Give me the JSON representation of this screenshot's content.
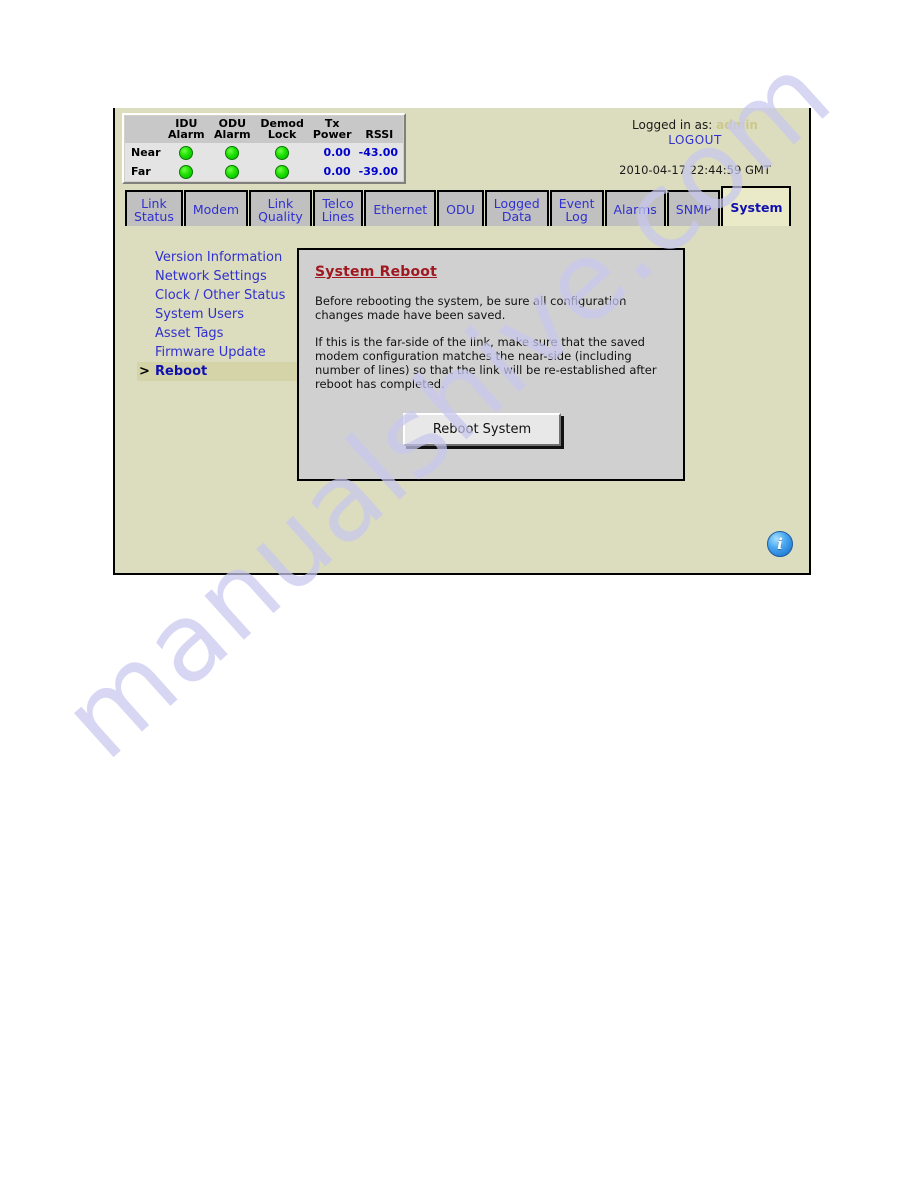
{
  "watermark": {
    "text": "manualshive.com"
  },
  "status_panel": {
    "columns": [
      "",
      "IDU\nAlarm",
      "ODU\nAlarm",
      "Demod\nLock",
      "Tx\nPower",
      "RSSI"
    ],
    "rows": [
      {
        "label": "Near",
        "idu_alarm": "led-green",
        "odu_alarm": "led-green",
        "demod_lock": "led-green",
        "tx_power": "0.00",
        "rssi": "-43.00"
      },
      {
        "label": "Far",
        "idu_alarm": "led-green",
        "odu_alarm": "led-green",
        "demod_lock": "led-green",
        "tx_power": "0.00",
        "rssi": "-39.00"
      }
    ]
  },
  "session": {
    "logged_in_prefix": "Logged in as:",
    "username": "admin",
    "logout_label": "LOGOUT",
    "timestamp": "2010-04-17 22:44:59 GMT"
  },
  "tabs": [
    {
      "label": "Link\nStatus",
      "active": false
    },
    {
      "label": "Modem",
      "active": false
    },
    {
      "label": "Link\nQuality",
      "active": false
    },
    {
      "label": "Telco\nLines",
      "active": false
    },
    {
      "label": "Ethernet",
      "active": false
    },
    {
      "label": "ODU",
      "active": false
    },
    {
      "label": "Logged\nData",
      "active": false
    },
    {
      "label": "Event\nLog",
      "active": false
    },
    {
      "label": "Alarms",
      "active": false
    },
    {
      "label": "SNMP",
      "active": false
    },
    {
      "label": "System",
      "active": true
    }
  ],
  "sidebar": {
    "marker": ">",
    "items": [
      {
        "label": "Version Information",
        "selected": false
      },
      {
        "label": "Network Settings",
        "selected": false
      },
      {
        "label": "Clock / Other Status",
        "selected": false
      },
      {
        "label": "System Users",
        "selected": false
      },
      {
        "label": "Asset Tags",
        "selected": false
      },
      {
        "label": "Firmware Update",
        "selected": false
      },
      {
        "label": "Reboot",
        "selected": true
      }
    ]
  },
  "content": {
    "title": "System Reboot",
    "paragraph1": "Before rebooting the system, be sure all configuration changes made have been saved.",
    "paragraph2": "If this is the far-side of the link, make sure that the saved modem configuration matches the near-side (including number of lines) so that the link will be re-established after reboot has completed.",
    "reboot_button_label": "Reboot System"
  },
  "info_icon": {
    "glyph": "i",
    "name": "info-icon"
  },
  "colors": {
    "page_background": "#dcdcbe",
    "tab_inactive": "#c0c0c0",
    "tab_active": "#eaeac8",
    "link_blue": "#3030d0",
    "heading_red": "#a01820",
    "panel_gray": "#d0d0d0",
    "led_green": "#1ee000",
    "value_blue": "#0000cc",
    "watermark": "#c8c8f0"
  }
}
